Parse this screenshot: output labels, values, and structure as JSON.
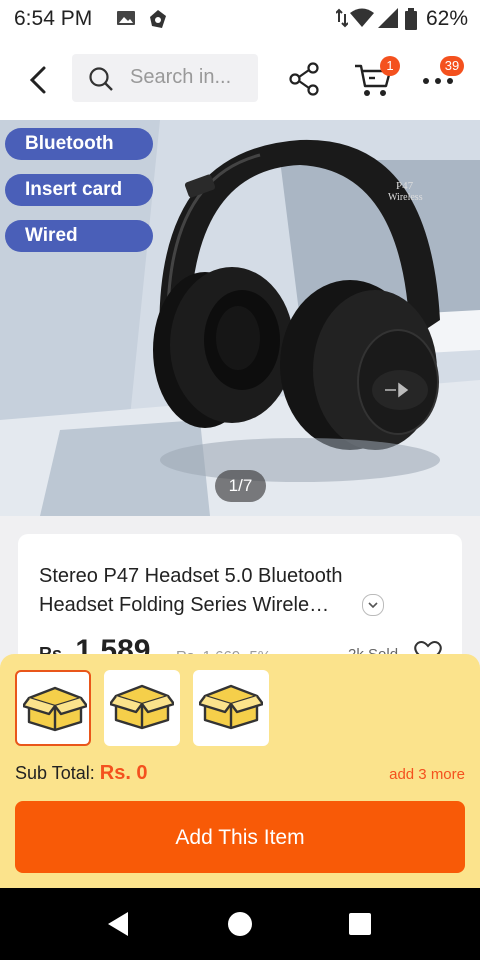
{
  "status_bar": {
    "time": "6:54 PM",
    "battery": "62%"
  },
  "header": {
    "search_placeholder": "Search in...",
    "cart_badge": "1",
    "more_badge": "39"
  },
  "gallery": {
    "chips": [
      "Bluetooth",
      "Insert card",
      "Wired"
    ],
    "counter": "1/7",
    "headset_text": [
      "P47",
      "Wireless"
    ]
  },
  "product": {
    "title": "Stereo P47 Headset 5.0 Bluetooth Headset Folding Series Wirele…",
    "currency": "Rs.",
    "price": "1,589",
    "old_price": "Rs. 1,669",
    "discount": "-5%",
    "sold": "2k Sold"
  },
  "sheet": {
    "variants": [
      "box",
      "box",
      "box"
    ],
    "subtotal_label": "Sub Total:",
    "subtotal_value": "Rs. 0",
    "add_more": "add 3 more",
    "add_button": "Add This Item"
  },
  "colors": {
    "accent": "#f85a07",
    "badge": "#f4511e",
    "chip": "#4a5fb8",
    "sheet": "#fbe38c"
  }
}
